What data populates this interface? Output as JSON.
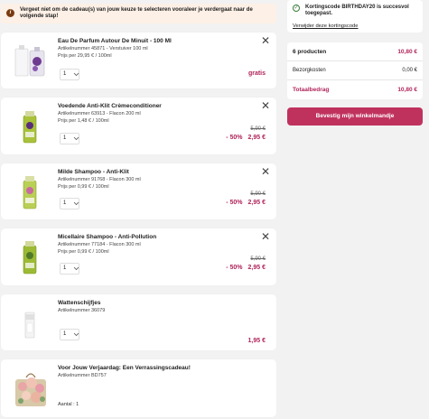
{
  "alert": {
    "text": "Vergeet niet om de cadeau(s) van jouw keuze te selecteren vooraleer je verdergaat naar de volgende stap!"
  },
  "items": [
    {
      "name": "Eau De Parfum Autour De Minuit - 100 Ml",
      "meta1": "Artikelnummer 45871 - Verstuiver 100 ml",
      "meta2": "Prijs per 29,95 € / 100ml",
      "qty": "1",
      "price": "gratis"
    },
    {
      "name": "Voedende Anti-Klit Crèmeconditioner",
      "meta1": "Artikelnummer 63913 - Flacon 200 ml",
      "meta2": "Prijs per 1,48 € / 100ml",
      "qty": "1",
      "old_price": "5,90 €",
      "discount": "- 50%",
      "price": "2,95 €"
    },
    {
      "name": "Milde Shampoo - Anti-Klit",
      "meta1": "Artikelnummer 91768 - Flacon 300 ml",
      "meta2": "Prijs per 0,99 € / 100ml",
      "qty": "1",
      "old_price": "5,90 €",
      "discount": "- 50%",
      "price": "2,95 €"
    },
    {
      "name": "Micellaire Shampoo - Anti-Pollution",
      "meta1": "Artikelnummer 77184 - Flacon 300 ml",
      "meta2": "Prijs per 0,99 € / 100ml",
      "qty": "1",
      "old_price": "5,90 €",
      "discount": "- 50%",
      "price": "2,95 €"
    },
    {
      "name": "Wattenschijfjes",
      "meta1": "Artikelnummer 36079",
      "qty": "1",
      "price": "1,95 €"
    },
    {
      "name": "Voor Jouw Verjaardag: Een Verrassingscadeau!",
      "meta1": "Artikelnummer BD757",
      "aantal": "Aantal : 1"
    }
  ],
  "summary": {
    "success": "Kortingscode BIRTHDAY20 is succesvol toegepast.",
    "remove_link": "Verwijder deze kortingscode",
    "products_label": "6 producten",
    "products_value": "10,80 €",
    "shipping_label": "Bezorgkosten",
    "shipping_value": "0,00 €",
    "total_label": "Totaalbedrag",
    "total_value": "10,80 €",
    "confirm_label": "Bevestig mijn winkelmandje"
  },
  "colors": {
    "accent": "#c0325e",
    "price": "#b0245a",
    "alert_bg": "#fdf0e6",
    "success": "#3a7d3a"
  },
  "icons": {
    "info": "info-icon",
    "close": "close-icon",
    "chevron": "chevron-down-icon",
    "check": "check-icon"
  }
}
